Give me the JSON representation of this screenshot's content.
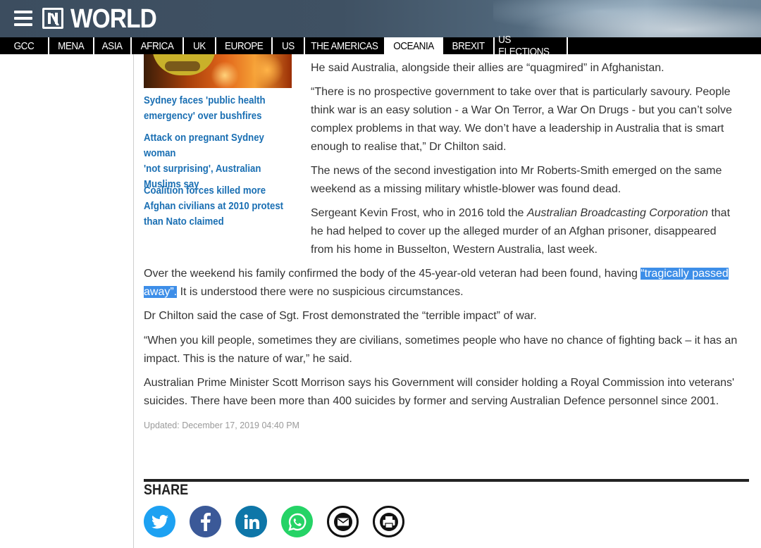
{
  "header": {
    "section_title": "WORLD",
    "menu_icon": "hamburger-menu-icon",
    "logo_icon": "news-logo-icon"
  },
  "nav": {
    "items": [
      {
        "label": "GCC",
        "active": false
      },
      {
        "label": "MENA",
        "active": false
      },
      {
        "label": "ASIA",
        "active": false
      },
      {
        "label": "AFRICA",
        "active": false
      },
      {
        "label": "UK",
        "active": false
      },
      {
        "label": "EUROPE",
        "active": false
      },
      {
        "label": "US",
        "active": false
      },
      {
        "label": "THE AMERICAS",
        "active": false
      },
      {
        "label": "OCEANIA",
        "active": true
      },
      {
        "label": "BREXIT",
        "active": false
      },
      {
        "label": "US ELECTIONS",
        "active": false
      }
    ]
  },
  "related": {
    "items": [
      {
        "lines": [
          "Sydney faces 'public health",
          "emergency' over bushfires"
        ]
      },
      {
        "lines": [
          "Attack on pregnant Sydney woman",
          "'not surprising', Australian",
          "Muslims say"
        ]
      },
      {
        "lines": [
          "Coalition forces killed more",
          "Afghan civilians at 2010 protest",
          "than Nato claimed"
        ]
      }
    ]
  },
  "article": {
    "p1": "He said Australia, alongside their allies are “quagmired” in Afghanistan.",
    "p2": "“There is no prospective government to take over that is particularly savoury. People think war is an easy solution - a War On Terror, a War On Drugs - but you can’t solve complex problems in that way. We don’t have a leadership in Australia that is smart enough to realise that,” Dr Chilton said.",
    "p3": "The news of the second investigation into Mr Roberts-Smith emerged on the same weekend as a missing military whistle-blower was found dead.",
    "p4_a": "Sergeant Kevin Frost, who in 2016 told the ",
    "p4_em": "Australian Broadcasting Corporation",
    "p4_b": " that he had helped to cover up the alleged murder of an Afghan prisoner, disappeared from his home in Busselton, Western Australia, last week.",
    "p5_a": "Over the weekend his family confirmed the body of the 45-year-old veteran had been found, having ",
    "p5_hl": "“tragically passed away”.",
    "p5_b": " It is understood there were no suspicious circumstances.",
    "p6": "Dr Chilton said the case of Sgt. Frost demonstrated the “terrible impact” of war.",
    "p7": "“When you kill people, sometimes they are civilians, sometimes people who have no chance of fighting back – it has an impact. This is the nature of war,” he said.",
    "p8": "Australian Prime Minister Scott Morrison says his Government will consider holding a Royal Commission into veterans' suicides. There have been more than 400 suicides by former and serving Australian Defence personnel since 2001.",
    "updated": "Updated: December 17, 2019 04:40 PM"
  },
  "share": {
    "label": "SHARE",
    "buttons": [
      {
        "icon": "twitter-icon",
        "color": "#1da1f2"
      },
      {
        "icon": "facebook-icon",
        "color": "#3b5998"
      },
      {
        "icon": "linkedin-icon",
        "color": "#0e76a8"
      },
      {
        "icon": "whatsapp-icon",
        "color": "#25d366"
      },
      {
        "icon": "email-icon",
        "color": "#ffffff"
      },
      {
        "icon": "print-icon",
        "color": "#ffffff"
      }
    ]
  }
}
